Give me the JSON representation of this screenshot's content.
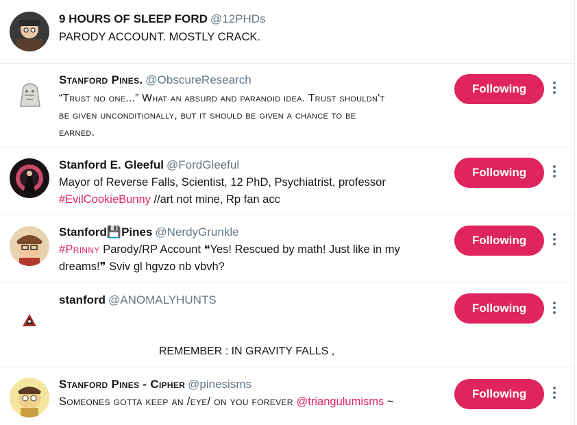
{
  "rows": [
    {
      "name": "9 HOURS OF SLEEP FORD",
      "handle": "@12PHDs",
      "bio": "PARODY ACCOUNT. MOSTLY CRACK."
    },
    {
      "name": "Stanford Pines.",
      "handle": "@ObscureResearch",
      "bio_line1": "“Trust no one...” What an absurd and paranoid idea. Trust shouldn't",
      "bio_line2": "be given unconditionally, but it should be given a chance to be",
      "bio_line3": "earned.",
      "button": "Following"
    },
    {
      "name": "Stanford E. Gleeful",
      "handle": "@FordGleeful",
      "bio_line1": "Mayor of Reverse Falls, Scientist, 12 PhD, Psychiatrist, professor",
      "bio_tag": "#EvilCookieBunny",
      "bio_rest": " //art not mine, Rp fan acc",
      "button": "Following"
    },
    {
      "name_a": "Stanford",
      "name_emoji": "💾",
      "name_b": "Pines",
      "handle": "@NerdyGrunkle",
      "bio_tag": "#Prinny",
      "bio_line1": " Parody/RP Account ❝Yes! Rescued by math! Just like in my",
      "bio_line2": "dreams!❞ Sviv gl hgvzo nb vbvh?",
      "button": "Following"
    },
    {
      "name": "stanford",
      "handle": "@ANOMALYHUNTS",
      "banner": "REMEMBER : IN GRAVITY FALLS ,",
      "button": "Following"
    },
    {
      "name": "Stanford Pines - Cipher",
      "handle": "@pinesisms",
      "bio_text": "Someones gotta keep an /eye/ on you forever ",
      "bio_mention": "@triangulumisms",
      "bio_tail": " ~",
      "button": "Following"
    }
  ],
  "colors": {
    "accent": "#e0245e",
    "handle": "#657786",
    "divider": "#e6ecf0"
  }
}
